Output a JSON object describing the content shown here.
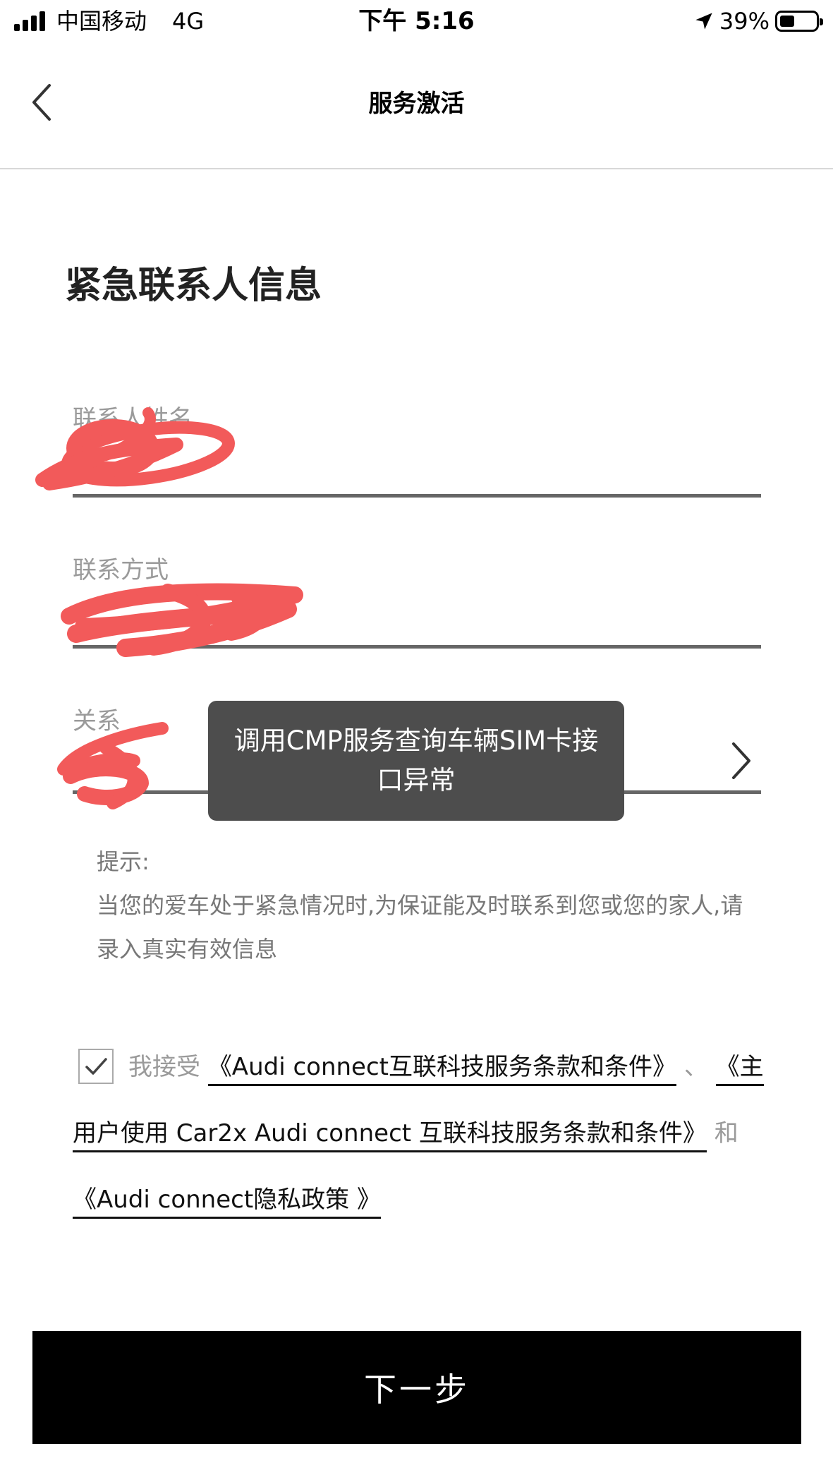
{
  "status_bar": {
    "carrier": "中国移动",
    "network": "4G",
    "time": "下午 5:16",
    "battery_percent": "39%",
    "battery_level": 0.39,
    "icons": [
      "signal-icon",
      "location-arrow-icon",
      "battery-icon"
    ]
  },
  "nav": {
    "title": "服务激活",
    "back_icon": "chevron-left-icon"
  },
  "section": {
    "title": "紧急联系人信息"
  },
  "form": {
    "fields": [
      {
        "label": "联系人姓名",
        "value": ""
      },
      {
        "label": "联系方式",
        "value": ""
      },
      {
        "label": "关系",
        "value": ""
      }
    ],
    "redaction_color": "#f25a5a"
  },
  "toast": {
    "message": "调用CMP服务查询车辆SIM卡接口异常"
  },
  "hint": {
    "title": "提示:",
    "body": "当您的爱车处于紧急情况时,为保证能及时联系到您或您的家人,请录入真实有效信息"
  },
  "agreement": {
    "checked": true,
    "prefix": "我接受",
    "link1": "《Audi connect互联科技服务条款和条件》",
    "sep1": "、",
    "link2_part1": "《主",
    "link2_part2": "用户使用 Car2x Audi connect 互联科技服务条款和条件》",
    "sep2": "和",
    "link3": "《Audi connect隐私政策 》"
  },
  "button": {
    "next": "下一步"
  }
}
